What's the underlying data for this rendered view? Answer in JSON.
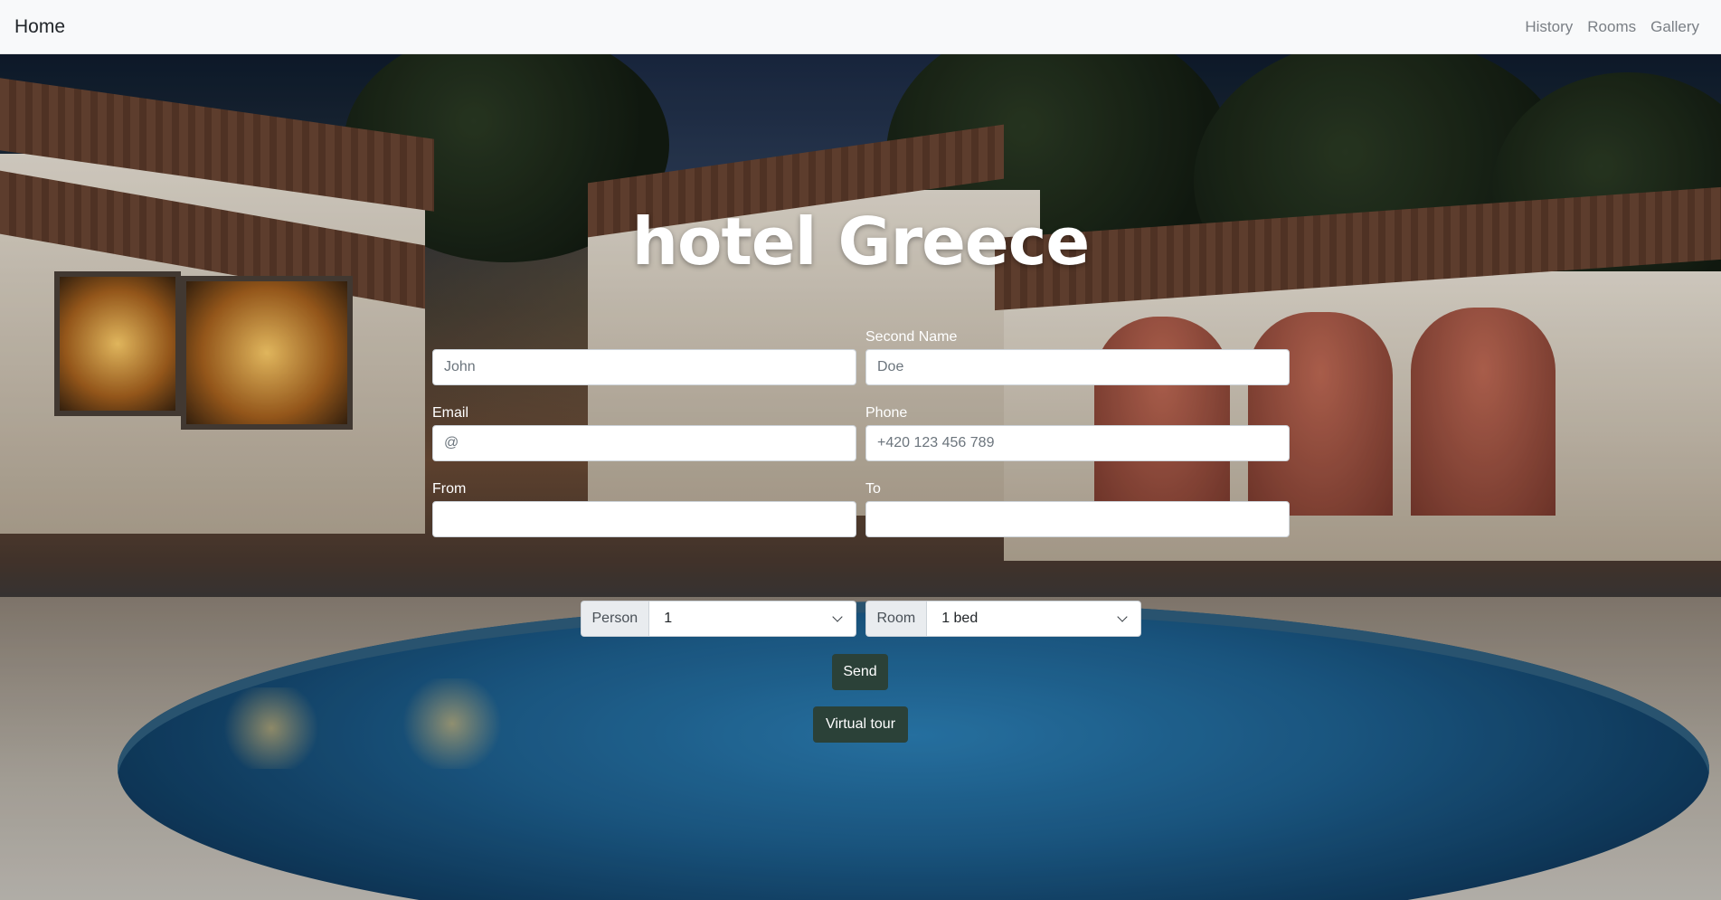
{
  "navbar": {
    "brand": "Home",
    "links": [
      "History",
      "Rooms",
      "Gallery"
    ]
  },
  "hero": {
    "title": "hotel Greece"
  },
  "form": {
    "first_name": {
      "label": "",
      "placeholder": "John"
    },
    "second_name": {
      "label": "Second Name",
      "placeholder": "Doe"
    },
    "email": {
      "label": "Email",
      "placeholder": "@"
    },
    "phone": {
      "label": "Phone",
      "placeholder": "+420 123 456 789"
    },
    "from": {
      "label": "From",
      "placeholder": ""
    },
    "to": {
      "label": "To",
      "placeholder": ""
    },
    "person": {
      "label": "Person",
      "value": "1"
    },
    "room": {
      "label": "Room",
      "value": "1 bed"
    },
    "send_label": "Send",
    "virtual_tour_label": "Virtual tour"
  },
  "icons": {
    "select_chevron": "chevron-down-icon"
  },
  "colors": {
    "navbar_bg": "#f8f9fa",
    "button_bg": "#2b4138",
    "title": "#ffffff"
  }
}
